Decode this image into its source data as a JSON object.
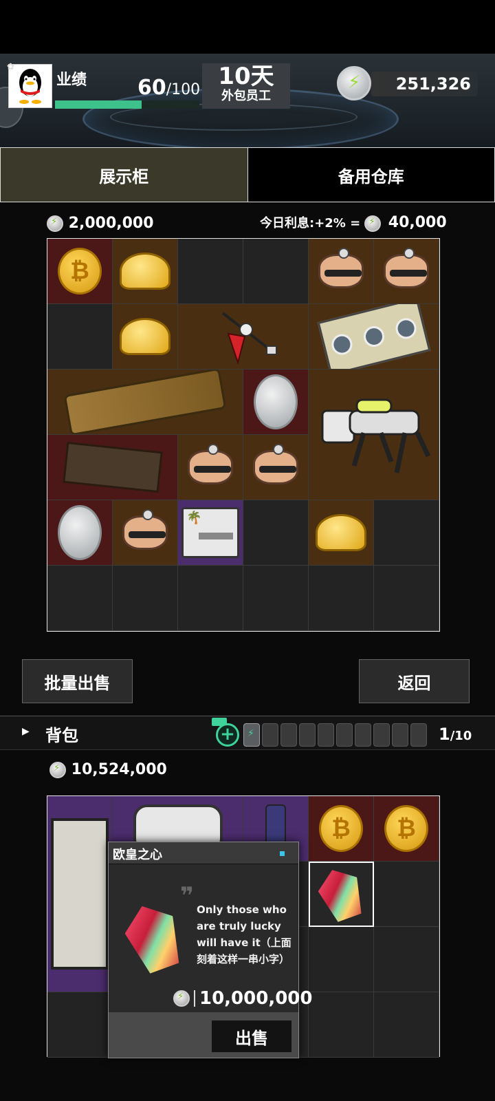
{
  "hud": {
    "performance_label": "业绩",
    "performance_current": "60",
    "performance_max": "/100",
    "performance_fraction": 0.6,
    "days_value": "10天",
    "role_label": "外包员工",
    "currency_amount": "251,326"
  },
  "tabs": {
    "showcase_label": "展示柜",
    "storage_label": "备用仓库"
  },
  "showcase": {
    "total_value": "2,000,000",
    "interest_label": "今日利息:+2% =",
    "interest_value": "40,000",
    "items": [
      {
        "name": "bitcoin",
        "bg": "red"
      },
      {
        "name": "gold-ingot",
        "bg": "brown"
      },
      {
        "name": "empty",
        "bg": "empty"
      },
      {
        "name": "empty",
        "bg": "empty"
      },
      {
        "name": "robot-head",
        "bg": "brown"
      },
      {
        "name": "robot-head",
        "bg": "brown"
      }
    ]
  },
  "buttons": {
    "bulk_sell": "批量出售",
    "back": "返回"
  },
  "backpack": {
    "label": "背包",
    "slots_used": "1",
    "slots_total": "/10",
    "total_value": "10,524,000"
  },
  "popup": {
    "title": "欧皇之心",
    "description": "Only those who are truly lucky will have it（上面刻着这样一串小字）",
    "price": "10,000,000",
    "sell_label": "出售"
  },
  "colors": {
    "accent_green": "#3cc28a",
    "cell_red": "#4b1717",
    "cell_brown": "#4a2e12",
    "cell_purple": "#4b2c6d"
  },
  "icons": [
    "gear-icon",
    "bolt-coin-icon",
    "plus-icon",
    "battery-icon",
    "video-icon"
  ]
}
